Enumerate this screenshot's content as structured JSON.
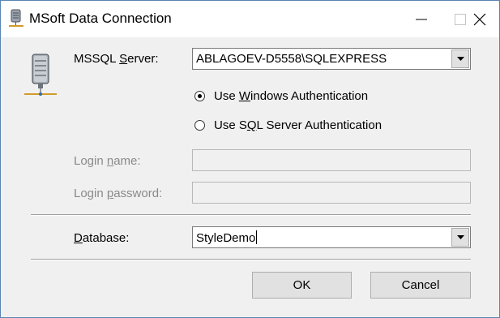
{
  "window": {
    "title": "MSoft Data Connection",
    "icon": "server-icon"
  },
  "titlebar_buttons": {
    "minimize_icon": "minimize-icon",
    "maximize_icon": "maximize-icon",
    "close_icon": "close-icon"
  },
  "server": {
    "label_pre": "MSSQL ",
    "label_accel": "S",
    "label_post": "erver:",
    "value": "ABLAGOEV-D5558\\SQLEXPRESS"
  },
  "auth": {
    "windows_pre": "Use ",
    "windows_accel": "W",
    "windows_post": "indows Authentication",
    "windows_selected": true,
    "sql_pre": "Use S",
    "sql_accel": "Q",
    "sql_post": "L Server Authentication",
    "sql_selected": false
  },
  "login": {
    "name_pre": "Login ",
    "name_accel": "n",
    "name_post": "ame:",
    "name_value": "",
    "password_pre": "Login ",
    "password_accel": "p",
    "password_post": "assword:",
    "password_value": ""
  },
  "database": {
    "label_accel": "D",
    "label_post": "atabase:",
    "value": "StyleDemo"
  },
  "buttons": {
    "ok": "OK",
    "cancel": "Cancel"
  },
  "colors": {
    "window_bg": "#f0f0f0",
    "title_bg": "#ffffff",
    "disabled_text": "#8a8a8a"
  }
}
